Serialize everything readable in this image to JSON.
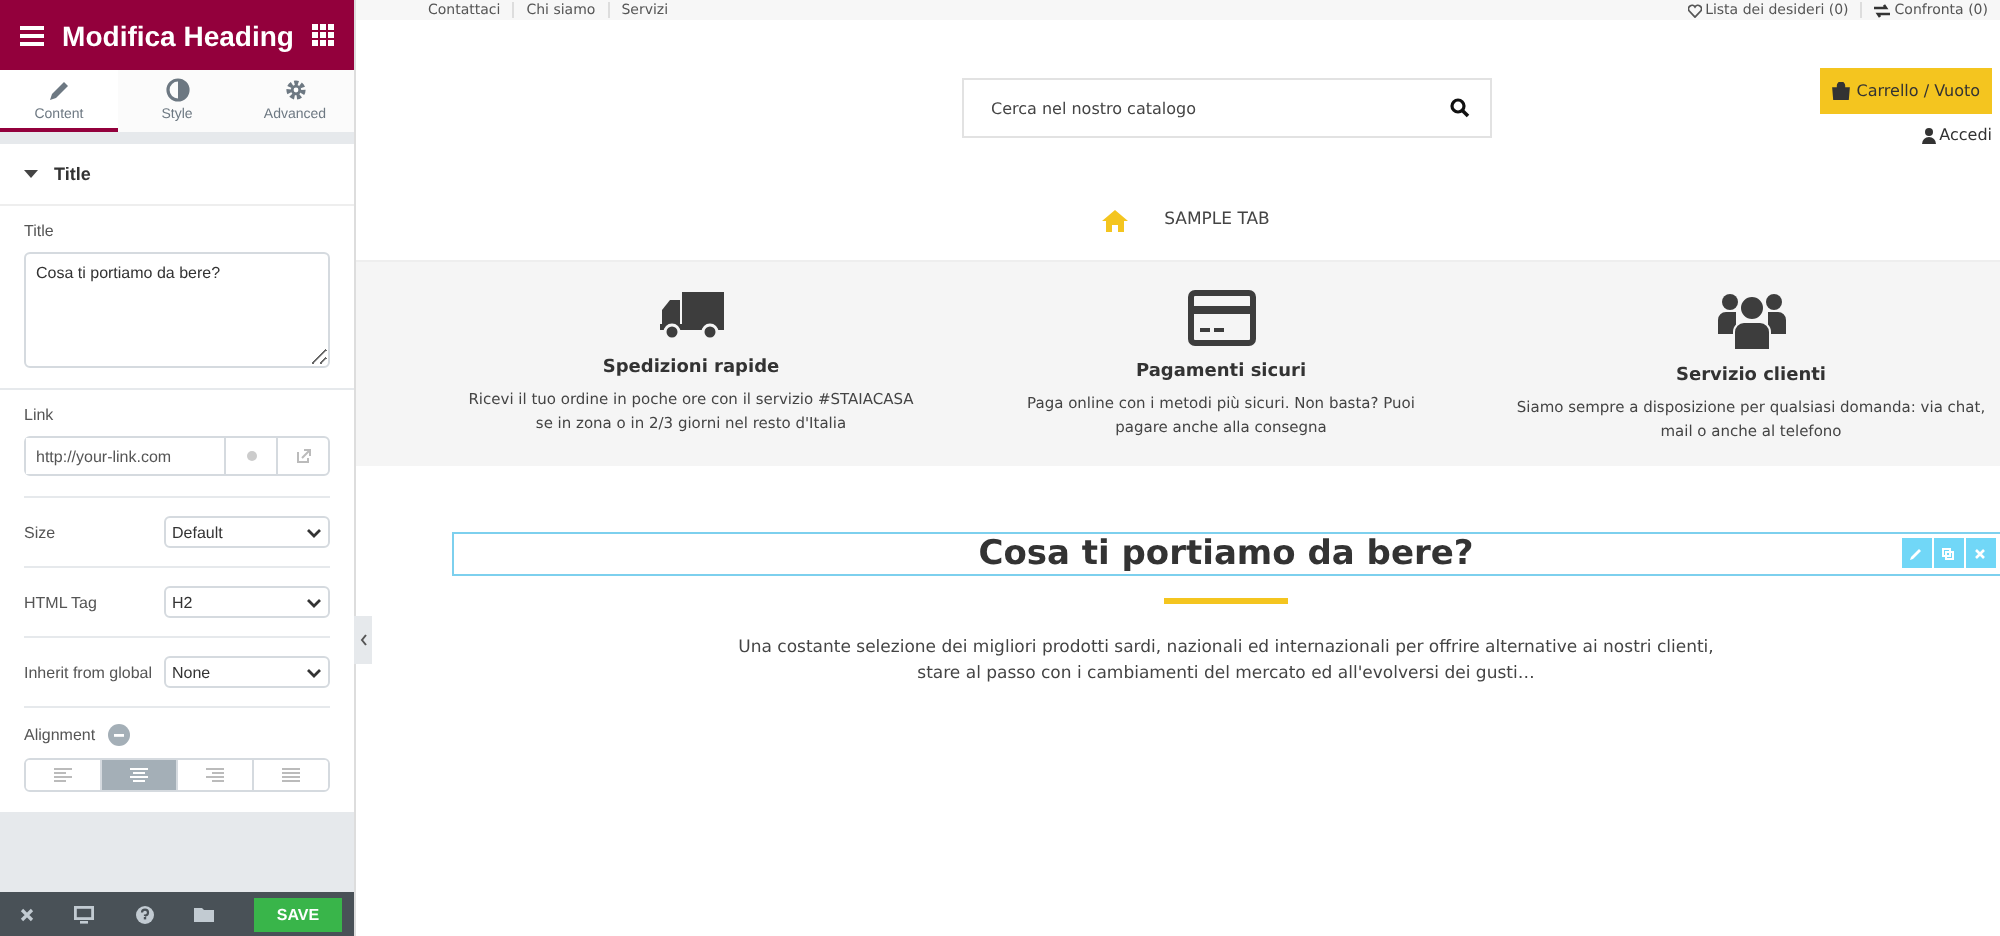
{
  "panel": {
    "title": "Modifica Heading",
    "tabs": [
      {
        "label": "Content",
        "selected": true
      },
      {
        "label": "Style",
        "selected": false
      },
      {
        "label": "Advanced",
        "selected": false
      }
    ],
    "section": {
      "title": "Title",
      "expanded": true
    },
    "title_field": {
      "label": "Title",
      "value": "Cosa ti portiamo da bere?"
    },
    "link_field": {
      "label": "Link",
      "placeholder": "http://your-link.com"
    },
    "selects": [
      {
        "label": "Size",
        "value": "Default"
      },
      {
        "label": "HTML Tag",
        "value": "H2"
      },
      {
        "label": "Inherit from global",
        "value": "None"
      }
    ],
    "alignment": {
      "label": "Alignment",
      "options": [
        {
          "kind": "left",
          "selected": false
        },
        {
          "kind": "center",
          "selected": true
        },
        {
          "kind": "right",
          "selected": false
        },
        {
          "kind": "justify",
          "selected": false
        }
      ]
    },
    "footer": {
      "save": "SAVE"
    }
  },
  "site": {
    "top_links": [
      "Contattaci",
      "Chi siamo",
      "Servizi"
    ],
    "top_right": [
      {
        "kind": "heart",
        "label": "Lista dei desideri (0)"
      },
      {
        "kind": "compare",
        "label": "Confronta (0)"
      }
    ],
    "search": {
      "placeholder": "Cerca nel nostro catalogo"
    },
    "cart": "Carrello / Vuoto",
    "login": "Accedi",
    "nav_tab": "SAMPLE TAB",
    "features": [
      {
        "kind": "truck",
        "title": "Spedizioni rapide",
        "lines": [
          "Ricevi il tuo ordine in poche ore con il servizio #STAIACASA",
          "se in zona o in 2/3 giorni nel resto d'Italia"
        ]
      },
      {
        "kind": "card",
        "title": "Pagamenti sicuri",
        "lines": [
          "Paga online con i metodi più sicuri. Non basta? Puoi",
          "pagare anche alla consegna"
        ]
      },
      {
        "kind": "people",
        "title": "Servizio clienti",
        "lines": [
          "Siamo sempre a disposizione per qualsiasi domanda: via chat,",
          "mail o anche al telefono"
        ]
      }
    ],
    "heading": "Cosa ti portiamo da bere?",
    "paragraph_lines": [
      "Una costante selezione dei migliori prodotti sardi, nazionali ed internazionali per offrire alternative ai nostri clienti,",
      "stare al passo con i cambiamenti del mercato ed all'evolversi dei gusti…"
    ]
  }
}
